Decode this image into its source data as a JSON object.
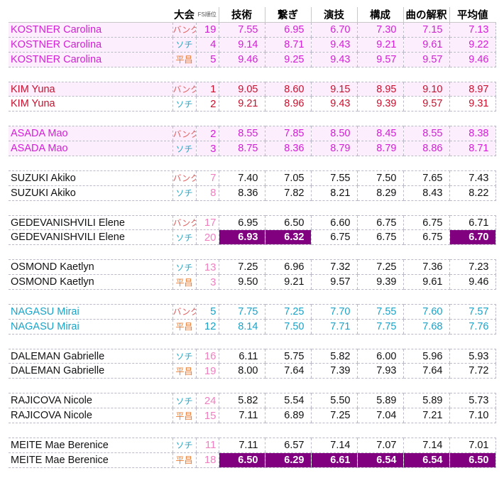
{
  "header": {
    "name": "",
    "competition": "大会",
    "fs_rank": "FS順位",
    "scores": [
      "技術",
      "繋ぎ",
      "演技",
      "構成",
      "曲の解釈",
      "平均値"
    ]
  },
  "groups": [
    {
      "color_class": "c-kostner",
      "rows": [
        {
          "name": "KOSTNER Carolina",
          "comp": "バンク",
          "comp_class": "",
          "rank": "19",
          "scores": [
            "7.55",
            "6.95",
            "6.70",
            "7.30",
            "7.15",
            "7.13"
          ],
          "highlight": [],
          "bg": "pink"
        },
        {
          "name": "KOSTNER Carolina",
          "comp": "ソチ",
          "comp_class": "sochi",
          "rank": "4",
          "scores": [
            "9.14",
            "8.71",
            "9.43",
            "9.21",
            "9.61",
            "9.22"
          ],
          "highlight": [],
          "bg": "pink"
        },
        {
          "name": "KOSTNER Carolina",
          "comp": "平昌",
          "comp_class": "pc",
          "rank": "5",
          "scores": [
            "9.46",
            "9.25",
            "9.43",
            "9.57",
            "9.57",
            "9.46"
          ],
          "highlight": [],
          "bg": "pink"
        }
      ]
    },
    {
      "color_class": "c-kim",
      "rows": [
        {
          "name": "KIM Yuna",
          "comp": "バンク",
          "comp_class": "",
          "rank": "1",
          "scores": [
            "9.05",
            "8.60",
            "9.15",
            "8.95",
            "9.10",
            "8.97"
          ],
          "highlight": [],
          "bg": "pink"
        },
        {
          "name": "KIM Yuna",
          "comp": "ソチ",
          "comp_class": "sochi",
          "rank": "2",
          "scores": [
            "9.21",
            "8.96",
            "9.43",
            "9.39",
            "9.57",
            "9.31"
          ],
          "highlight": [],
          "bg": "white"
        }
      ]
    },
    {
      "color_class": "c-asada",
      "rows": [
        {
          "name": "ASADA Mao",
          "comp": "バンク",
          "comp_class": "",
          "rank": "2",
          "scores": [
            "8.55",
            "7.85",
            "8.50",
            "8.45",
            "8.55",
            "8.38"
          ],
          "highlight": [],
          "bg": "pink"
        },
        {
          "name": "ASADA Mao",
          "comp": "ソチ",
          "comp_class": "sochi",
          "rank": "3",
          "scores": [
            "8.75",
            "8.36",
            "8.79",
            "8.79",
            "8.86",
            "8.71"
          ],
          "highlight": [],
          "bg": "pink"
        }
      ]
    },
    {
      "color_class": "c-black",
      "rank_faded": true,
      "rows": [
        {
          "name": "SUZUKI Akiko",
          "comp": "バンク",
          "comp_class": "",
          "rank": "7",
          "scores": [
            "7.40",
            "7.05",
            "7.55",
            "7.50",
            "7.65",
            "7.43"
          ],
          "highlight": [],
          "bg": "white"
        },
        {
          "name": "SUZUKI Akiko",
          "comp": "ソチ",
          "comp_class": "sochi",
          "rank": "8",
          "scores": [
            "8.36",
            "7.82",
            "8.21",
            "8.29",
            "8.43",
            "8.22"
          ],
          "highlight": [],
          "bg": "white"
        }
      ]
    },
    {
      "color_class": "c-black",
      "rank_faded": true,
      "rows": [
        {
          "name": "GEDEVANISHVILI Elene",
          "comp": "バンク",
          "comp_class": "",
          "rank": "17",
          "scores": [
            "6.95",
            "6.50",
            "6.60",
            "6.75",
            "6.75",
            "6.71"
          ],
          "highlight": [],
          "bg": "white"
        },
        {
          "name": "GEDEVANISHVILI Elene",
          "comp": "ソチ",
          "comp_class": "sochi",
          "rank": "20",
          "scores": [
            "6.93",
            "6.32",
            "6.75",
            "6.75",
            "6.75",
            "6.70"
          ],
          "highlight": [
            0,
            1,
            5
          ],
          "bg": "white"
        }
      ]
    },
    {
      "color_class": "c-black",
      "rank_faded": true,
      "rows": [
        {
          "name": "OSMOND Kaetlyn",
          "comp": "ソチ",
          "comp_class": "sochi",
          "rank": "13",
          "scores": [
            "7.25",
            "6.96",
            "7.32",
            "7.25",
            "7.36",
            "7.23"
          ],
          "highlight": [],
          "bg": "white"
        },
        {
          "name": "OSMOND Kaetlyn",
          "comp": "平昌",
          "comp_class": "pc",
          "rank": "3",
          "scores": [
            "9.50",
            "9.21",
            "9.57",
            "9.39",
            "9.61",
            "9.46"
          ],
          "highlight": [],
          "bg": "white"
        }
      ]
    },
    {
      "color_class": "c-nagasu",
      "rows": [
        {
          "name": "NAGASU Mirai",
          "comp": "バンク",
          "comp_class": "",
          "rank": "5",
          "scores": [
            "7.75",
            "7.25",
            "7.70",
            "7.55",
            "7.60",
            "7.57"
          ],
          "highlight": [],
          "bg": "white"
        },
        {
          "name": "NAGASU Mirai",
          "comp": "平昌",
          "comp_class": "pc",
          "rank": "12",
          "scores": [
            "8.14",
            "7.50",
            "7.71",
            "7.75",
            "7.68",
            "7.76"
          ],
          "highlight": [],
          "bg": "white"
        }
      ]
    },
    {
      "color_class": "c-black",
      "rank_faded": true,
      "rows": [
        {
          "name": "DALEMAN Gabrielle",
          "comp": "ソチ",
          "comp_class": "sochi",
          "rank": "16",
          "scores": [
            "6.11",
            "5.75",
            "5.82",
            "6.00",
            "5.96",
            "5.93"
          ],
          "highlight": [],
          "bg": "white"
        },
        {
          "name": "DALEMAN Gabrielle",
          "comp": "平昌",
          "comp_class": "pc",
          "rank": "19",
          "scores": [
            "8.00",
            "7.64",
            "7.39",
            "7.93",
            "7.64",
            "7.72"
          ],
          "highlight": [],
          "bg": "white"
        }
      ]
    },
    {
      "color_class": "c-black",
      "rank_faded": true,
      "rows": [
        {
          "name": "RAJICOVA Nicole",
          "comp": "ソチ",
          "comp_class": "sochi",
          "rank": "24",
          "scores": [
            "5.82",
            "5.54",
            "5.50",
            "5.89",
            "5.89",
            "5.73"
          ],
          "highlight": [],
          "bg": "white"
        },
        {
          "name": "RAJICOVA Nicole",
          "comp": "平昌",
          "comp_class": "pc",
          "rank": "15",
          "scores": [
            "7.11",
            "6.89",
            "7.25",
            "7.04",
            "7.21",
            "7.10"
          ],
          "highlight": [],
          "bg": "white"
        }
      ]
    },
    {
      "color_class": "c-black",
      "rank_faded": true,
      "rows": [
        {
          "name": "MEITE Mae Berenice",
          "comp": "ソチ",
          "comp_class": "sochi",
          "rank": "11",
          "scores": [
            "7.11",
            "6.57",
            "7.14",
            "7.07",
            "7.14",
            "7.01"
          ],
          "highlight": [],
          "bg": "white"
        },
        {
          "name": "MEITE Mae Berenice",
          "comp": "平昌",
          "comp_class": "pc",
          "rank": "18",
          "scores": [
            "6.50",
            "6.29",
            "6.61",
            "6.54",
            "6.54",
            "6.50"
          ],
          "highlight": [
            0,
            1,
            2,
            3,
            4,
            5
          ],
          "bg": "white"
        }
      ]
    }
  ]
}
